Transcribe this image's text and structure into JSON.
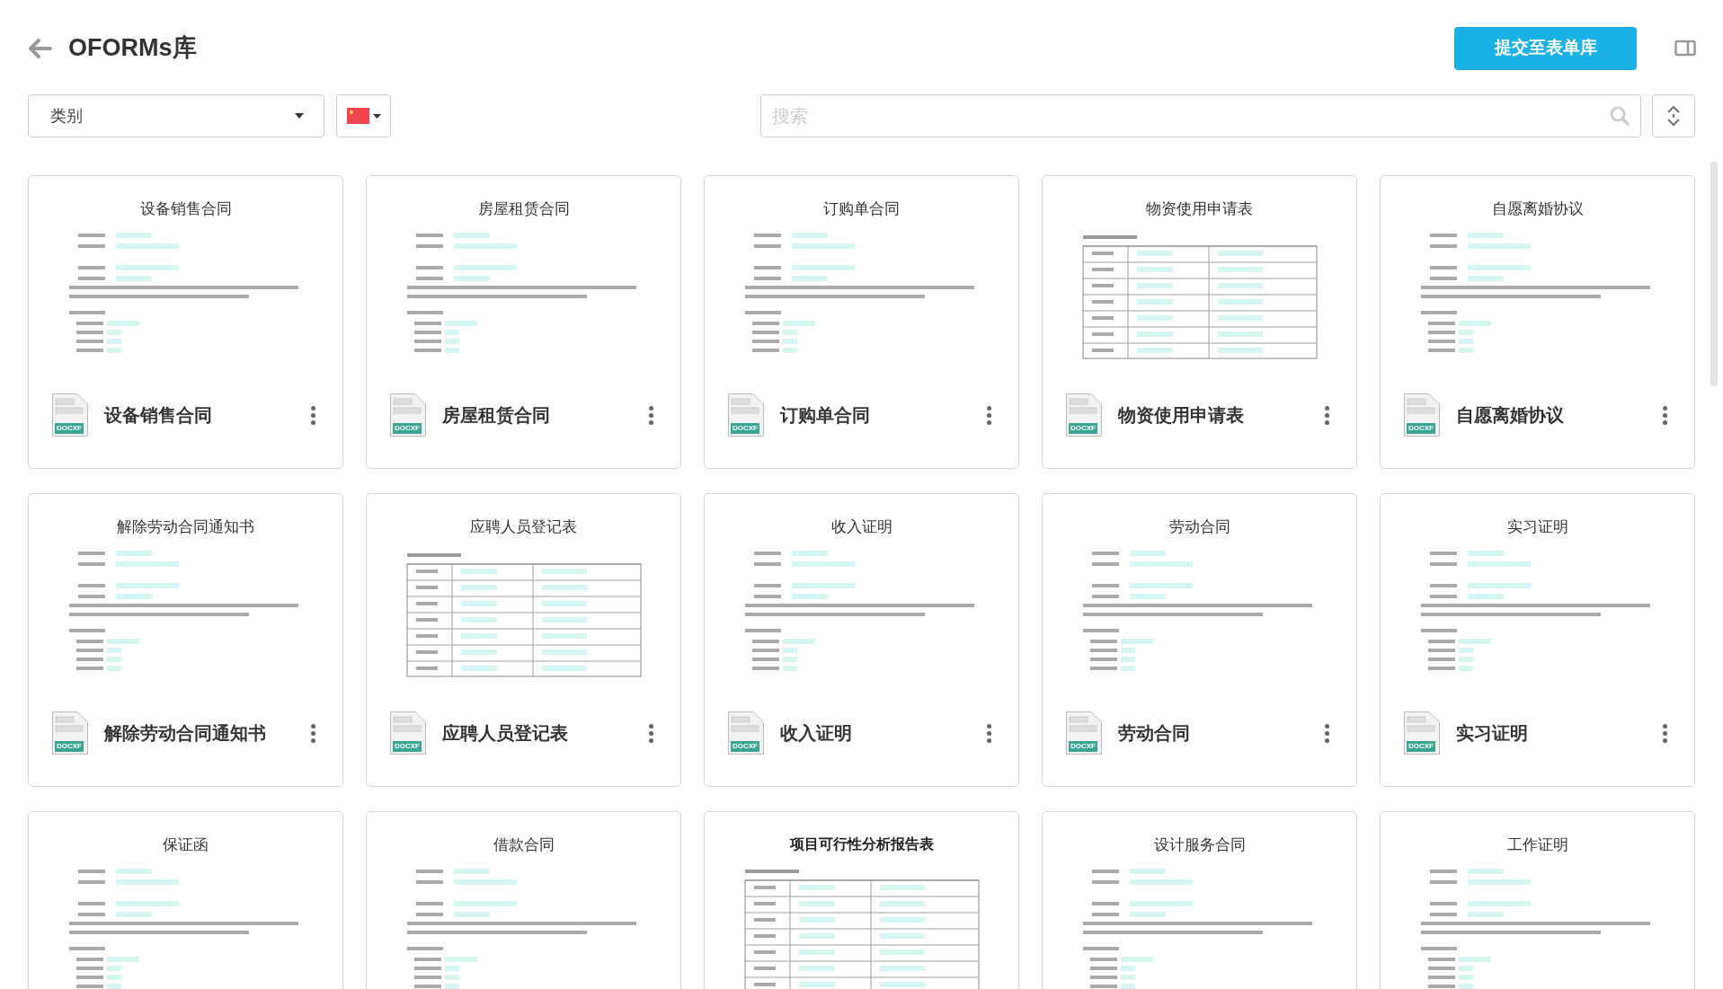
{
  "header": {
    "title": "OFORMs库",
    "submit_button": "提交至表单库"
  },
  "filters": {
    "category": {
      "value": "类别"
    },
    "search": {
      "placeholder": "搜索"
    }
  },
  "templates": [
    {
      "preview_title": "设备销售合同",
      "kind": "text",
      "name": "设备销售合同",
      "file_badge": "DOCXF"
    },
    {
      "preview_title": "房屋租赁合同",
      "kind": "text",
      "name": "房屋租赁合同",
      "file_badge": "DOCXF"
    },
    {
      "preview_title": "订购单合同",
      "kind": "text",
      "name": "订购单合同",
      "file_badge": "DOCXF"
    },
    {
      "preview_title": "物资使用申请表",
      "kind": "form",
      "name": "物资使用申请表",
      "file_badge": "DOCXF"
    },
    {
      "preview_title": "自愿离婚协议",
      "kind": "text",
      "name": "自愿离婚协议",
      "file_badge": "DOCXF"
    },
    {
      "preview_title": "解除劳动合同通知书",
      "kind": "text",
      "name": "解除劳动合同通知书",
      "file_badge": "DOCXF"
    },
    {
      "preview_title": "应聘人员登记表",
      "kind": "form",
      "name": "应聘人员登记表",
      "file_badge": "DOCXF"
    },
    {
      "preview_title": "收入证明",
      "kind": "text",
      "name": "收入证明",
      "file_badge": "DOCXF"
    },
    {
      "preview_title": "劳动合同",
      "kind": "text",
      "name": "劳动合同",
      "file_badge": "DOCXF"
    },
    {
      "preview_title": "实习证明",
      "kind": "text",
      "name": "实习证明",
      "file_badge": "DOCXF"
    },
    {
      "preview_title": "保证函",
      "kind": "text"
    },
    {
      "preview_title": "借款合同",
      "kind": "text"
    },
    {
      "preview_title": "项目可行性分析报告表",
      "kind": "form"
    },
    {
      "preview_title": "设计服务合同",
      "kind": "text"
    },
    {
      "preview_title": "工作证明",
      "kind": "text"
    }
  ]
}
